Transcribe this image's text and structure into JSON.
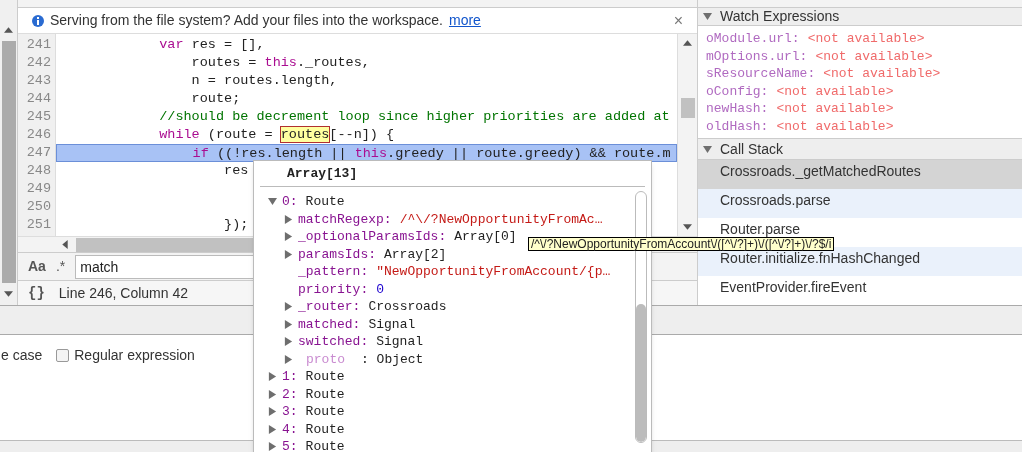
{
  "infobar": {
    "message": "Serving from the file system? Add your files into the workspace.",
    "link": "more",
    "close": "×"
  },
  "editor": {
    "lines": [
      {
        "number": "241",
        "selected": false,
        "tokens": [
          {
            "kind": "keyword",
            "text": "            var"
          },
          {
            "kind": "plain",
            "text": " res = [],"
          }
        ]
      },
      {
        "number": "242",
        "selected": false,
        "tokens": [
          {
            "kind": "plain",
            "text": "                routes = "
          },
          {
            "kind": "keyword",
            "text": "this"
          },
          {
            "kind": "plain",
            "text": "._routes,"
          }
        ]
      },
      {
        "number": "243",
        "selected": false,
        "tokens": [
          {
            "kind": "plain",
            "text": "                n = routes.length,"
          }
        ]
      },
      {
        "number": "244",
        "selected": false,
        "tokens": [
          {
            "kind": "plain",
            "text": "                route;"
          }
        ]
      },
      {
        "number": "245",
        "selected": false,
        "tokens": [
          {
            "kind": "comment",
            "text": "            //should be decrement loop since higher priorities are added at"
          }
        ]
      },
      {
        "number": "246",
        "selected": false,
        "tokens": [
          {
            "kind": "keyword",
            "text": "            while"
          },
          {
            "kind": "plain",
            "text": " (route = "
          },
          {
            "kind": "match",
            "text": "routes"
          },
          {
            "kind": "plain",
            "text": "[--n]) {"
          }
        ]
      },
      {
        "number": "247",
        "selected": true,
        "tokens": [
          {
            "kind": "keyword",
            "text": "                if"
          },
          {
            "kind": "plain",
            "text": " ((!res.length || "
          },
          {
            "kind": "keyword",
            "text": "this"
          },
          {
            "kind": "plain",
            "text": ".greedy || route.greedy) && route.m"
          }
        ]
      },
      {
        "number": "248",
        "selected": false,
        "tokens": [
          {
            "kind": "plain",
            "text": "                    res"
          }
        ]
      },
      {
        "number": "249",
        "selected": false
      },
      {
        "number": "250",
        "selected": false
      },
      {
        "number": "251",
        "selected": false,
        "tokens": [
          {
            "kind": "plain",
            "text": "                    });"
          }
        ]
      }
    ]
  },
  "search": {
    "case_label": "Aa",
    "regex_label": ".*",
    "value": "match"
  },
  "status": {
    "brace": "{}",
    "position": "Line 246, Column 42"
  },
  "options": [
    {
      "label": "e case",
      "kind": "text"
    },
    {
      "label": "Regular expression",
      "kind": "checkbox",
      "checked": false
    }
  ],
  "popover": {
    "title": "Array[13]",
    "tree": [
      {
        "key": "0:",
        "value": "Route",
        "kind": "object",
        "dimmed": false,
        "expanded": true,
        "children": [
          {
            "key": "matchRegexp:",
            "value": "/^\\/?NewOpportunityFromAc…",
            "kind": "string",
            "dimmed": false,
            "expanded": false
          },
          {
            "key": "_optionalParamsIds:",
            "value": "Array[0]",
            "kind": "object",
            "dimmed": false,
            "expanded": false
          },
          {
            "key": "paramsIds:",
            "value": "Array[2]",
            "kind": "object",
            "dimmed": false,
            "expanded": false
          },
          {
            "key": "_pattern:",
            "value": "\"NewOpportunityFromAccount/{p…",
            "kind": "string",
            "dimmed": false
          },
          {
            "key": "priority:",
            "value": "0",
            "kind": "number",
            "dimmed": false
          },
          {
            "key": "_router:",
            "value": "Crossroads",
            "kind": "object",
            "dimmed": false,
            "expanded": false
          },
          {
            "key": "matched:",
            "value": "Signal",
            "kind": "object",
            "dimmed": false,
            "expanded": false
          },
          {
            "key": "switched:",
            "value": "Signal",
            "kind": "object",
            "dimmed": false,
            "expanded": false
          },
          {
            "key": "proto",
            "value": ": Object",
            "kind": "object",
            "dimmed": true,
            "expanded": false
          }
        ]
      },
      {
        "key": "1:",
        "value": "Route",
        "kind": "object",
        "dimmed": false,
        "expanded": false
      },
      {
        "key": "2:",
        "value": "Route",
        "kind": "object",
        "dimmed": false,
        "expanded": false
      },
      {
        "key": "3:",
        "value": "Route",
        "kind": "object",
        "dimmed": false,
        "expanded": false
      },
      {
        "key": "4:",
        "value": "Route",
        "kind": "object",
        "dimmed": false,
        "expanded": false
      },
      {
        "key": "5:",
        "value": "Route",
        "kind": "object",
        "dimmed": false,
        "expanded": false
      }
    ]
  },
  "tooltip": {
    "text": "/^\\/?NewOpportunityFromAccount\\/([^\\/?]+)\\/([^\\/?]+)\\/?$/i"
  },
  "sidebar": {
    "watch": {
      "title": "Watch Expressions",
      "expanded": true,
      "items": [
        {
          "name": "oModule.url:",
          "value": "<not available>"
        },
        {
          "name": "mOptions.url:",
          "value": "<not available>"
        },
        {
          "name": "sResourceName:",
          "value": "<not available>"
        },
        {
          "name": "oConfig:",
          "value": "<not available>"
        },
        {
          "name": "newHash:",
          "value": "<not available>"
        },
        {
          "name": "oldHash:",
          "value": "<not available>"
        }
      ]
    },
    "call_stack": {
      "title": "Call Stack",
      "expanded": true,
      "frames": [
        {
          "label": "Crossroads._getMatchedRoutes",
          "selected": true
        },
        {
          "label": "Crossroads.parse",
          "selected": false
        },
        {
          "label": "Router.parse",
          "selected": false
        },
        {
          "label": "Router.initialize.fnHashChanged",
          "selected": false
        },
        {
          "label": "EventProvider.fireEvent",
          "selected": false
        }
      ]
    }
  }
}
